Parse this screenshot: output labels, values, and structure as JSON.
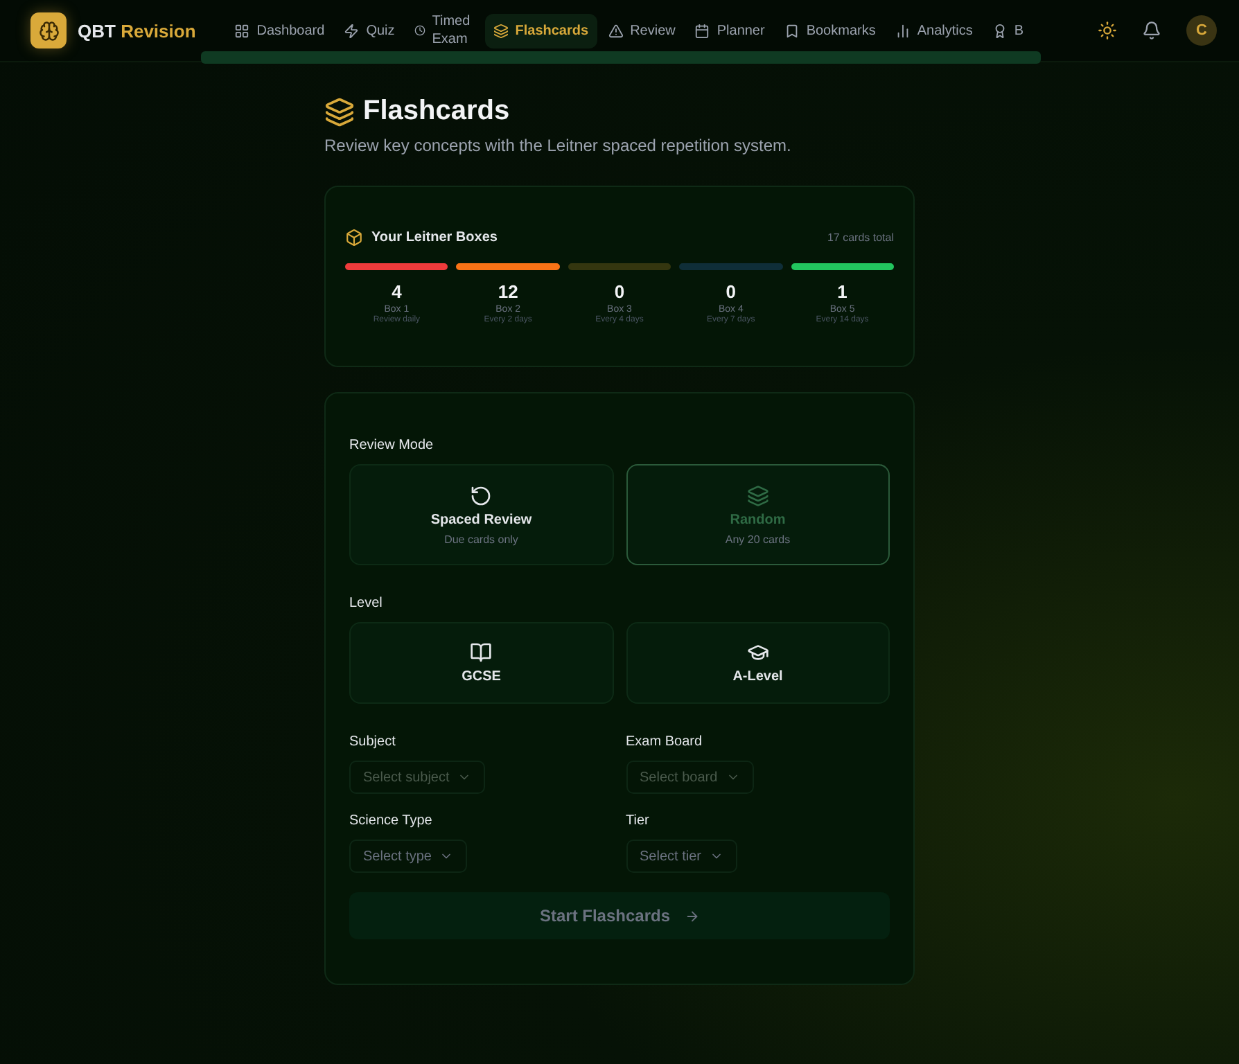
{
  "brand": {
    "name": "QBT",
    "accent": "Revision",
    "avatar": "C"
  },
  "nav": [
    {
      "label": "Dashboard",
      "kind": "grid",
      "selected": false
    },
    {
      "label": "Quiz",
      "kind": "zap",
      "selected": false
    },
    {
      "label": "Timed Exam",
      "kind": "clock",
      "selected": false
    },
    {
      "label": "Flashcards",
      "kind": "layers",
      "selected": true
    },
    {
      "label": "Review",
      "kind": "alert",
      "selected": false
    },
    {
      "label": "Planner",
      "kind": "calendar",
      "selected": false
    },
    {
      "label": "Bookmarks",
      "kind": "bookmark",
      "selected": false
    },
    {
      "label": "Analytics",
      "kind": "chart",
      "selected": false
    },
    {
      "label": "B",
      "kind": "award",
      "selected": false
    }
  ],
  "header": {
    "title": "Flashcards",
    "subtitle": "Review key concepts with the Leitner spaced repetition system."
  },
  "leitner": {
    "title": "Your Leitner Boxes",
    "total": "17 cards total",
    "boxes": [
      {
        "count": "4",
        "label": "Box 1",
        "interval": "Review daily",
        "color": "#ef3b3b"
      },
      {
        "count": "12",
        "label": "Box 2",
        "interval": "Every 2 days",
        "color": "#f97316"
      },
      {
        "count": "0",
        "label": "Box 3",
        "interval": "Every 4 days",
        "color": "#34360f"
      },
      {
        "count": "0",
        "label": "Box 4",
        "interval": "Every 7 days",
        "color": "#0f2e38"
      },
      {
        "count": "1",
        "label": "Box 5",
        "interval": "Every 14 days",
        "color": "#22c55e"
      }
    ]
  },
  "review_mode": {
    "label": "Review Mode",
    "options": [
      {
        "title": "Spaced Review",
        "subtitle": "Due cards only",
        "kind": "rotate",
        "selected": false
      },
      {
        "title": "Random",
        "subtitle": "Any 20 cards",
        "kind": "layers",
        "selected": true
      }
    ]
  },
  "level": {
    "label": "Level",
    "options": [
      {
        "title": "GCSE",
        "kind": "book",
        "selected": false
      },
      {
        "title": "A-Level",
        "kind": "cap",
        "selected": false
      }
    ]
  },
  "fields": [
    {
      "label": "Subject",
      "placeholder": "Select subject",
      "disabled": true
    },
    {
      "label": "Exam Board",
      "placeholder": "Select board",
      "disabled": true
    },
    {
      "label": "Science Type",
      "placeholder": "Select type",
      "disabled": false
    },
    {
      "label": "Tier",
      "placeholder": "Select tier",
      "disabled": false
    }
  ],
  "start_button": {
    "label": "Start Flashcards",
    "disabled": true
  }
}
